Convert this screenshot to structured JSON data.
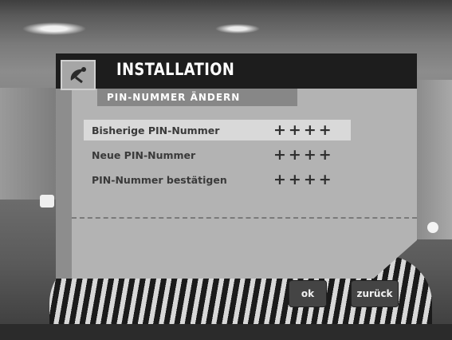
{
  "dialog": {
    "title": "INSTALLATION",
    "subtitle": "PIN-NUMMER ÄNDERN",
    "logo_icon": "satellite-dish-icon"
  },
  "rows": [
    {
      "label": "Bisherige PIN-Nummer",
      "value": "++++",
      "selected": true
    },
    {
      "label": "Neue PIN-Nummer",
      "value": "++++",
      "selected": false
    },
    {
      "label": "PIN-Nummer bestätigen",
      "value": "++++",
      "selected": false
    }
  ],
  "buttons": {
    "ok": "ok",
    "back": "zurück"
  }
}
